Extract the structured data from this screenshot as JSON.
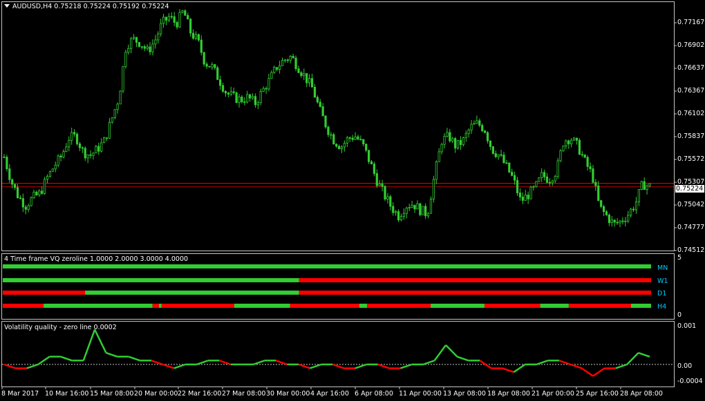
{
  "symbol_title": "AUDUSD,H4  0.75218 0.75224 0.75192 0.75224",
  "price_axis": [
    "0.77167",
    "0.76902",
    "0.76637",
    "0.76367",
    "0.76102",
    "0.75837",
    "0.75572",
    "0.75307",
    "0.75042",
    "0.74777",
    "0.74512"
  ],
  "current_price": "0.75224",
  "vq_panel": {
    "title": "4 Time frame VQ zeroline 1.0000 2.0000 3.0000 4.0000",
    "scale_top": "5",
    "scale_bottom": "0",
    "rows": [
      {
        "label": "MN",
        "segments": [
          {
            "to": 1.0,
            "state": "up"
          }
        ]
      },
      {
        "label": "W1",
        "segments": [
          {
            "to": 0.457,
            "state": "up"
          },
          {
            "to": 1.0,
            "state": "down"
          }
        ]
      },
      {
        "label": "D1",
        "segments": [
          {
            "to": 0.127,
            "state": "down"
          },
          {
            "to": 0.457,
            "state": "up"
          },
          {
            "to": 1.0,
            "state": "down"
          }
        ]
      },
      {
        "label": "H4",
        "segments": [
          {
            "to": 0.063,
            "state": "down"
          },
          {
            "to": 0.231,
            "state": "up"
          },
          {
            "to": 0.241,
            "state": "down"
          },
          {
            "to": 0.245,
            "state": "up"
          },
          {
            "to": 0.357,
            "state": "down"
          },
          {
            "to": 0.443,
            "state": "up"
          },
          {
            "to": 0.55,
            "state": "down"
          },
          {
            "to": 0.562,
            "state": "up"
          },
          {
            "to": 0.66,
            "state": "down"
          },
          {
            "to": 0.743,
            "state": "up"
          },
          {
            "to": 0.829,
            "state": "down"
          },
          {
            "to": 0.873,
            "state": "up"
          },
          {
            "to": 0.969,
            "state": "down"
          },
          {
            "to": 1.0,
            "state": "up"
          }
        ]
      }
    ]
  },
  "volq_panel": {
    "title": "Volatility quality - zero line 0.0002",
    "axis": [
      "0.001",
      "0.00",
      "-0.0004"
    ]
  },
  "time_axis": [
    "8 Mar 2017",
    "10 Mar 16:00",
    "15 Mar 08:00",
    "20 Mar 00:00",
    "22 Mar 16:00",
    "27 Mar 08:00",
    "30 Mar 00:00",
    "4 Apr 16:00",
    "6 Apr 08:00",
    "11 Apr 00:00",
    "13 Apr 08:00",
    "18 Apr 08:00",
    "21 Apr 00:00",
    "25 Apr 16:00",
    "28 Apr 08:00"
  ],
  "chart_data": {
    "type": "candlestick",
    "symbol": "AUDUSD",
    "timeframe": "H4",
    "ylim": [
      0.7448,
      0.7735
    ],
    "close_path": [
      0.7556,
      0.7528,
      0.751,
      0.75,
      0.7509,
      0.7514,
      0.7532,
      0.7546,
      0.7557,
      0.7578,
      0.758,
      0.7562,
      0.7558,
      0.7565,
      0.7575,
      0.76,
      0.7625,
      0.7685,
      0.7692,
      0.7688,
      0.7678,
      0.769,
      0.771,
      0.7718,
      0.771,
      0.7725,
      0.77,
      0.769,
      0.7665,
      0.766,
      0.7645,
      0.763,
      0.7625,
      0.7622,
      0.7625,
      0.7618,
      0.7632,
      0.7645,
      0.766,
      0.7668,
      0.7672,
      0.766,
      0.7648,
      0.7635,
      0.761,
      0.759,
      0.7575,
      0.7568,
      0.7578,
      0.758,
      0.757,
      0.755,
      0.7528,
      0.7512,
      0.7498,
      0.7488,
      0.75,
      0.7502,
      0.7495,
      0.749,
      0.7535,
      0.7575,
      0.758,
      0.7568,
      0.7575,
      0.759,
      0.7595,
      0.7588,
      0.7565,
      0.7558,
      0.7545,
      0.753,
      0.7505,
      0.7512,
      0.752,
      0.7535,
      0.753,
      0.754,
      0.7575,
      0.7578,
      0.7568,
      0.755,
      0.7535,
      0.7498,
      0.7488,
      0.7478,
      0.7482,
      0.749,
      0.7502,
      0.7525,
      0.7522
    ],
    "current_price": 0.75224,
    "vq_series": [
      0.0,
      -0.0001,
      -0.0001,
      0.0,
      0.0002,
      0.0002,
      0.0001,
      0.0001,
      0.0009,
      0.0003,
      0.0002,
      0.0002,
      0.0001,
      0.0001,
      0.0,
      -0.0001,
      0.0,
      0.0,
      0.0001,
      0.0001,
      0.0,
      0.0,
      0.0,
      0.0001,
      0.0001,
      0.0,
      0.0,
      -0.0001,
      0.0,
      0.0,
      -0.0001,
      -0.0001,
      0.0,
      0.0,
      -0.0001,
      -0.0001,
      0.0,
      0.0,
      0.0001,
      0.0005,
      0.0002,
      0.0001,
      0.0001,
      -0.0001,
      -0.0001,
      -0.0002,
      0.0,
      0.0,
      0.0001,
      0.0001,
      0.0,
      -0.0001,
      -0.0003,
      -0.0001,
      -0.0001,
      0.0,
      0.0003,
      0.0002
    ]
  },
  "colors": {
    "bull": "#32cd32",
    "bear": "#ff0000",
    "grid": "#c8c8c8",
    "price_line": "#ff0000",
    "label": "#00c8ff"
  }
}
